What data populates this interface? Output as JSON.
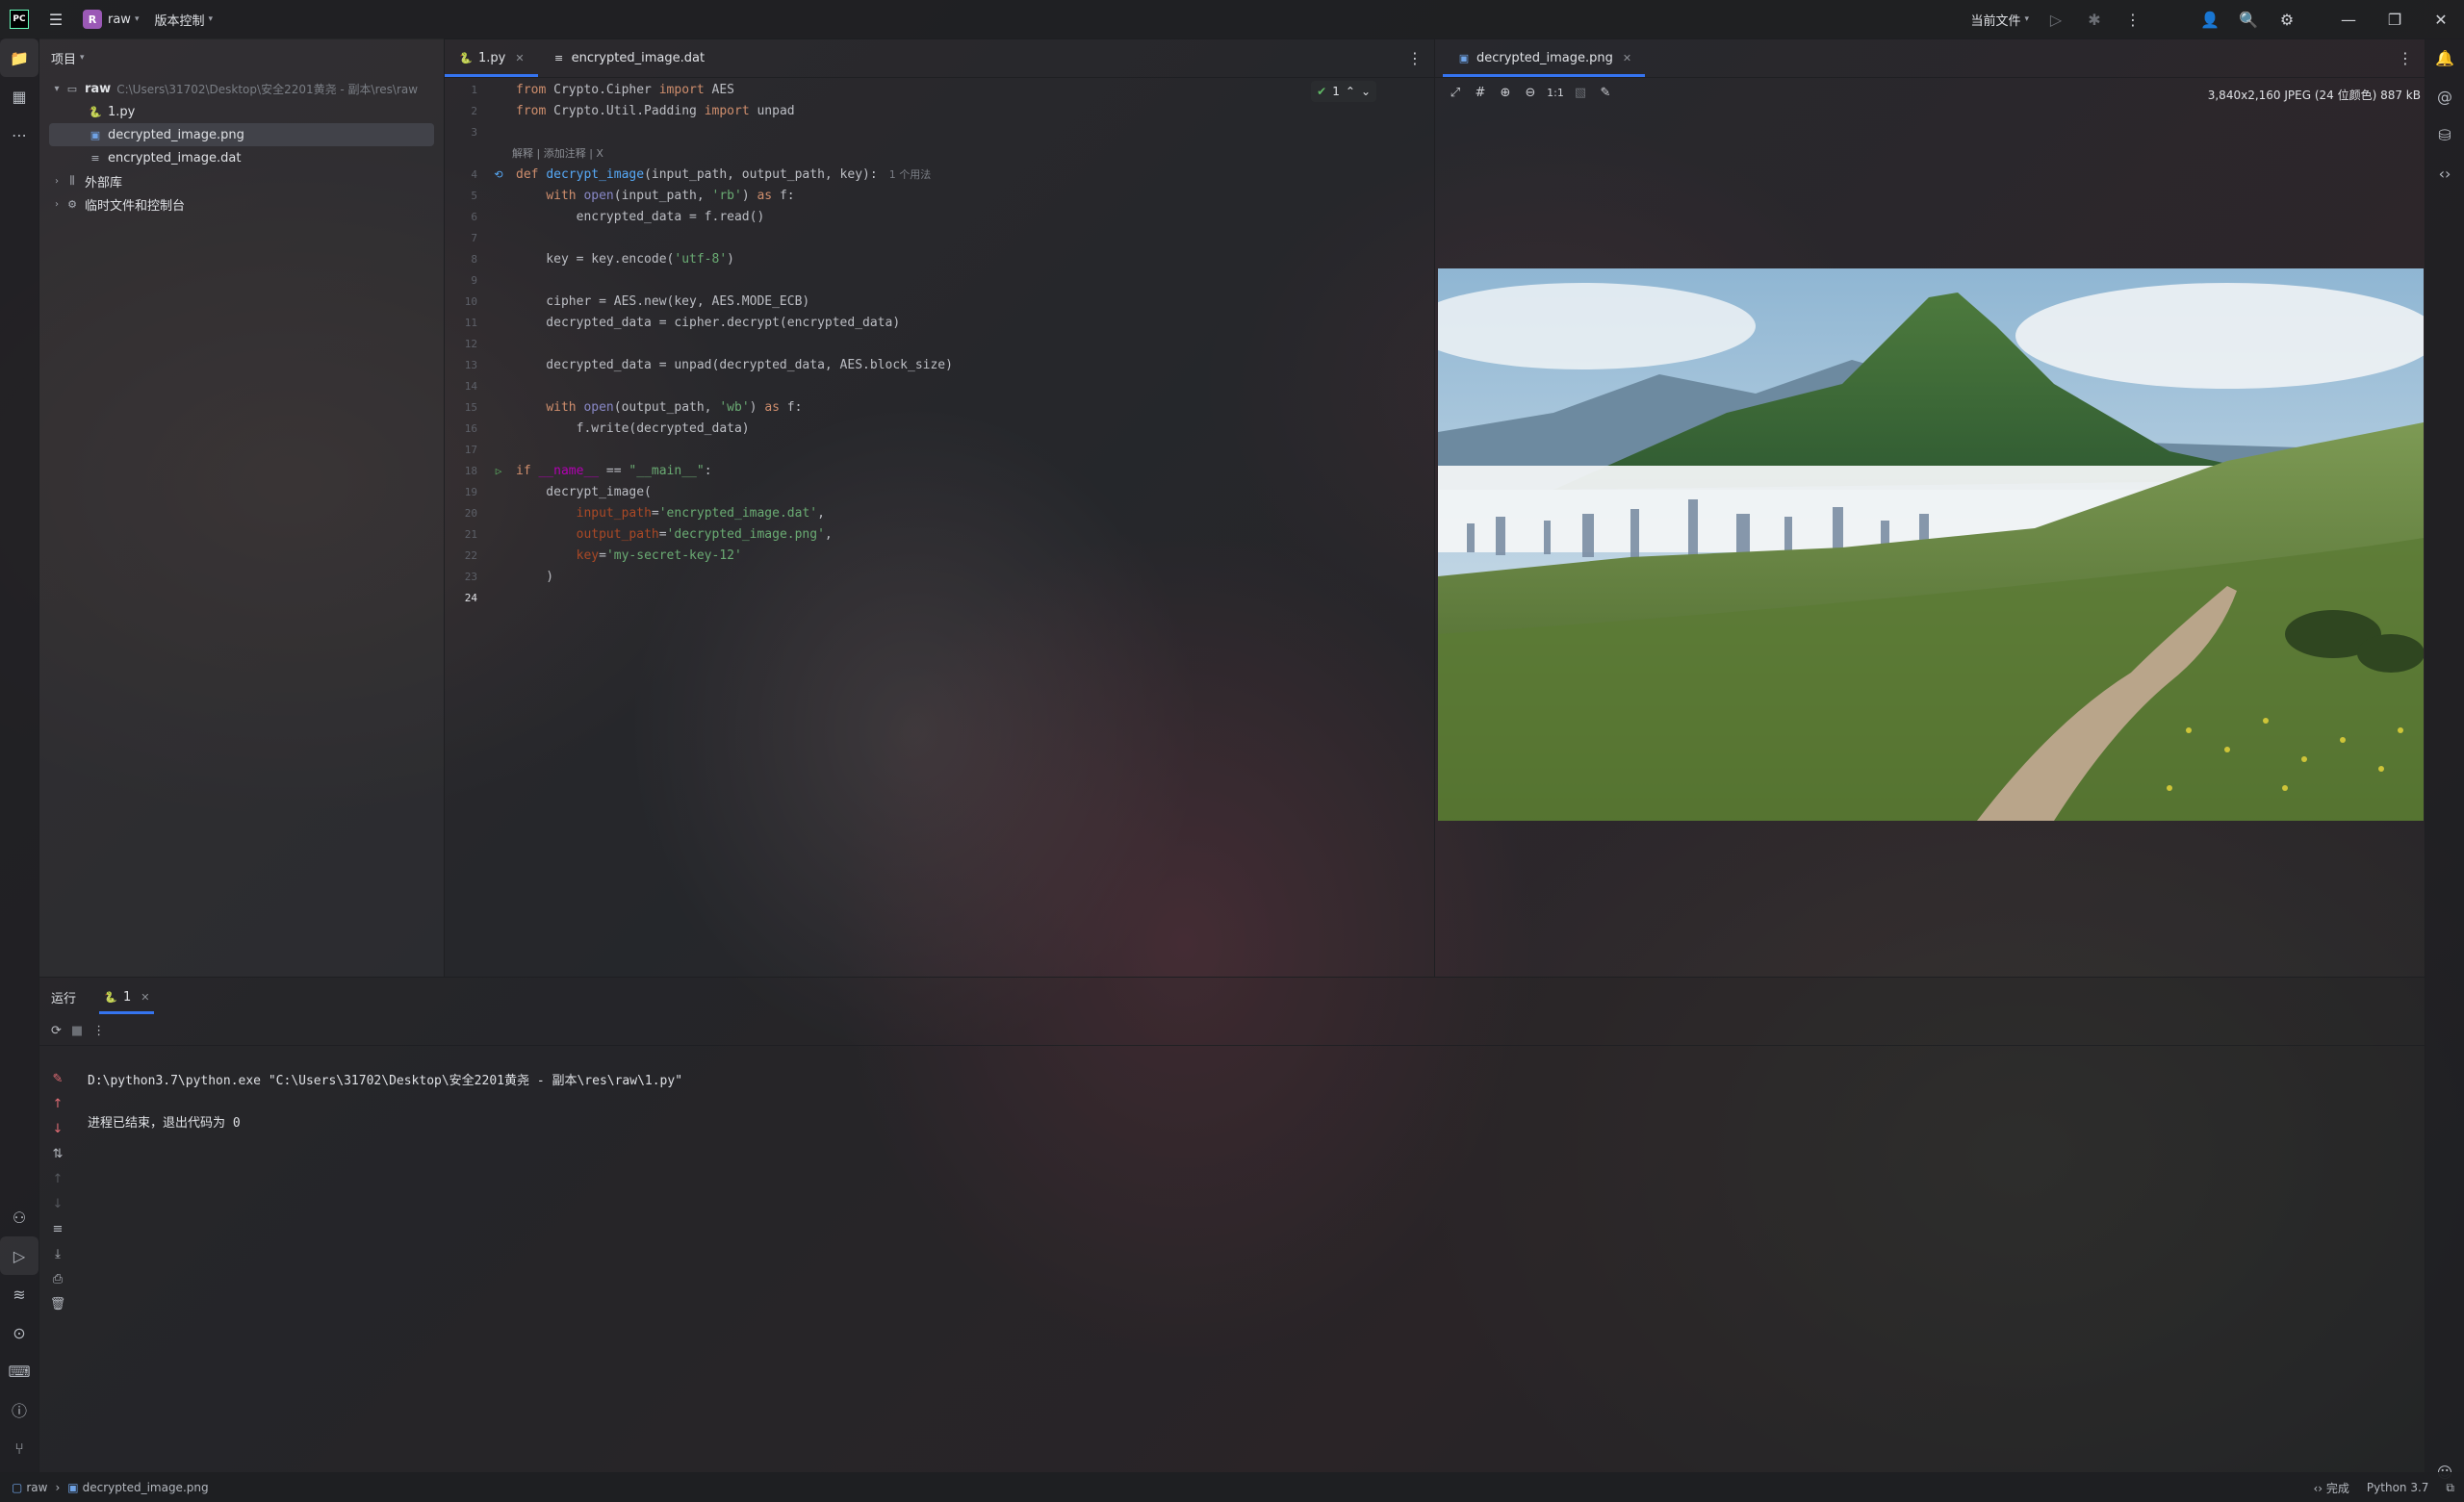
{
  "titlebar": {
    "project_initial": "R",
    "project_name": "raw",
    "vcs_label": "版本控制",
    "run_config": "当前文件"
  },
  "project_panel": {
    "title": "项目",
    "root_name": "raw",
    "root_path": "C:\\Users\\31702\\Desktop\\安全2201黄尧 - 副本\\res\\raw",
    "files": [
      "1.py",
      "decrypted_image.png",
      "encrypted_image.dat"
    ],
    "external_libs": "外部库",
    "scratches": "临时文件和控制台"
  },
  "editor_left": {
    "tabs": [
      {
        "label": "1.py",
        "active": true
      },
      {
        "label": "encrypted_image.dat",
        "active": false
      }
    ],
    "inspection_count": "1",
    "hint_text": "解释 | 添加注释 | X",
    "usage_hint": "1 个用法",
    "line_numbers": [
      "1",
      "2",
      "3",
      "4",
      "5",
      "6",
      "7",
      "8",
      "9",
      "10",
      "11",
      "12",
      "13",
      "14",
      "15",
      "16",
      "17",
      "18",
      "19",
      "20",
      "21",
      "22",
      "23",
      "24"
    ]
  },
  "editor_right": {
    "tab_label": "decrypted_image.png",
    "zoom_label": "1:1",
    "image_info": "3,840x2,160 JPEG (24 位颜色) 887 kB"
  },
  "run_panel": {
    "title": "运行",
    "tab_label": "1",
    "command": "D:\\python3.7\\python.exe \"C:\\Users\\31702\\Desktop\\安全2201黄尧 - 副本\\res\\raw\\1.py\"",
    "exit_message": "进程已结束，退出代码为 0"
  },
  "statusbar": {
    "crumb_root": "raw",
    "crumb_file": "decrypted_image.png",
    "status": "完成",
    "interpreter": "Python 3.7"
  },
  "colors": {
    "accent": "#3574f0",
    "keyword": "#cf8e6d",
    "function": "#56a8f5",
    "string": "#6aab73"
  }
}
